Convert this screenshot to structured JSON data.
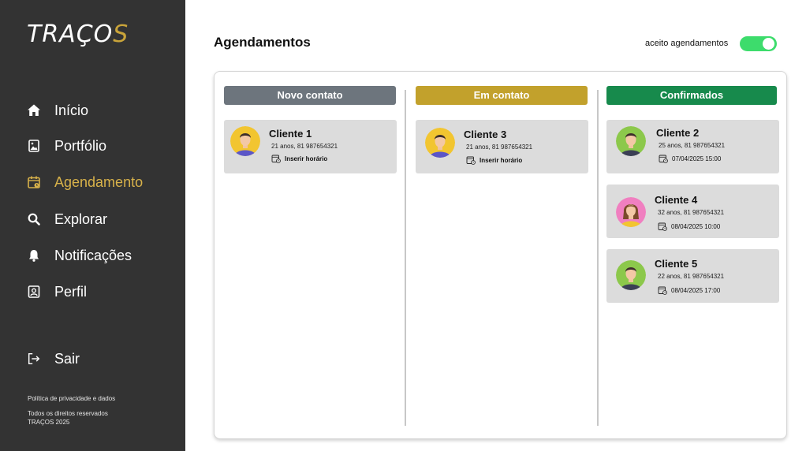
{
  "brand": {
    "logo_main": "TRAÇO",
    "logo_accent": "S"
  },
  "sidebar": {
    "items": [
      {
        "label": "Início",
        "icon": "home-icon"
      },
      {
        "label": "Portfólio",
        "icon": "image-icon"
      },
      {
        "label": "Agendamento",
        "icon": "calendar-icon"
      },
      {
        "label": "Explorar",
        "icon": "search-icon"
      },
      {
        "label": "Notificações",
        "icon": "bell-icon"
      },
      {
        "label": "Perfil",
        "icon": "user-badge-icon"
      }
    ],
    "logout": {
      "label": "Sair",
      "icon": "logout-icon"
    },
    "privacy": "Política de privacidade e dados",
    "rights": "Todos os direitos reservados",
    "copyright": "TRAÇOS 2025"
  },
  "header": {
    "title": "Agendamentos",
    "toggle_label": "aceito agendamentos",
    "toggle_on": true
  },
  "colors": {
    "sidebar_bg": "#333333",
    "accent_gold": "#c9a43a",
    "novo_contato": "#6d757d",
    "em_contato": "#c2a12c",
    "confirmados": "#178a4c",
    "toggle_on": "#3ddc6c"
  },
  "columns": [
    {
      "title": "Novo contato",
      "cards": [
        {
          "name": "Cliente 1",
          "info": "21 anos, 81 987654321",
          "schedule": "Inserir horário",
          "avatar": "male-avatar-yellow"
        }
      ]
    },
    {
      "title": "Em contato",
      "cards": [
        {
          "name": "Cliente 3",
          "info": "21 anos, 81 987654321",
          "schedule": "Inserir horário",
          "avatar": "male-avatar-yellow"
        }
      ]
    },
    {
      "title": "Confirmados",
      "cards": [
        {
          "name": "Cliente 2",
          "info": "25 anos, 81 987654321",
          "schedule": "07/04/2025 15:00",
          "avatar": "male-avatar-green"
        },
        {
          "name": "Cliente 4",
          "info": "32 anos, 81 987654321",
          "schedule": "08/04/2025 10:00",
          "avatar": "female-avatar-pink"
        },
        {
          "name": "Cliente 5",
          "info": "22 anos, 81 987654321",
          "schedule": "08/04/2025 17:00",
          "avatar": "male-avatar-green"
        }
      ]
    }
  ]
}
